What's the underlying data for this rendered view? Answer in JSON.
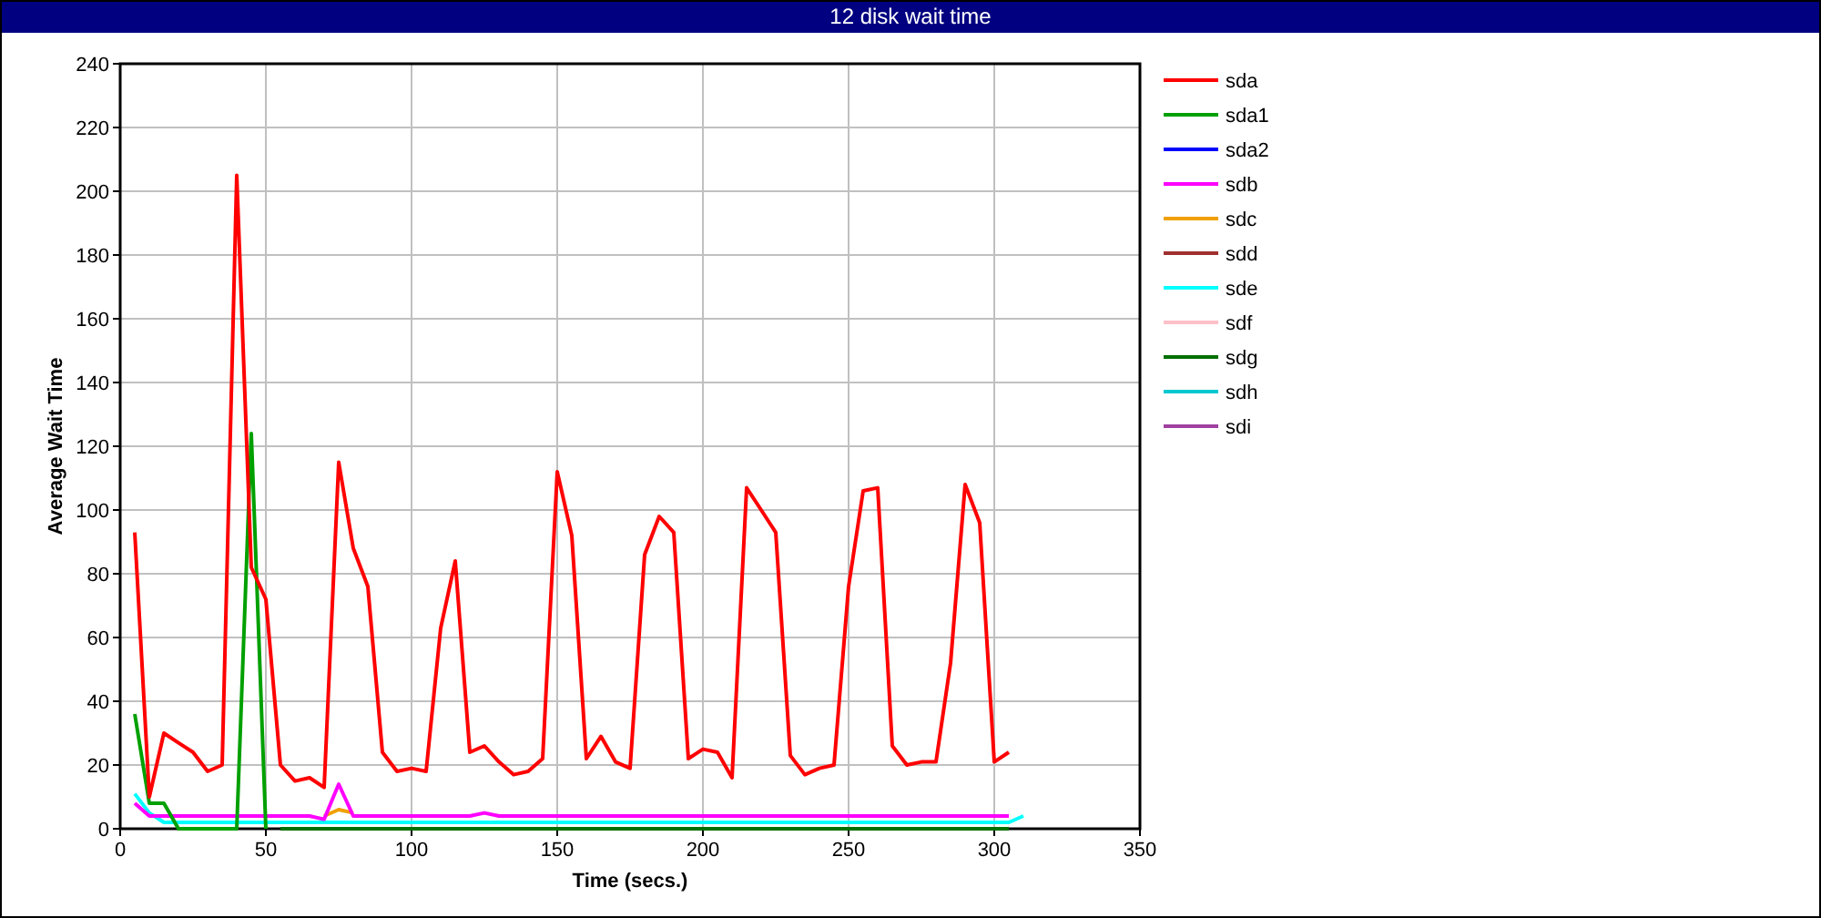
{
  "window": {
    "title": "12 disk wait time"
  },
  "chart": {
    "chart_data": {
      "type": "line",
      "xlabel": "Time (secs.)",
      "ylabel": "Average Wait Time",
      "grid": true,
      "legend": "right",
      "x": [
        5,
        10,
        15,
        20,
        25,
        30,
        35,
        40,
        45,
        50,
        55,
        60,
        65,
        70,
        75,
        80,
        85,
        90,
        95,
        100,
        105,
        110,
        115,
        120,
        125,
        130,
        135,
        140,
        145,
        150,
        155,
        160,
        165,
        170,
        175,
        180,
        185,
        190,
        195,
        200,
        205,
        210,
        215,
        220,
        225,
        230,
        235,
        240,
        245,
        250,
        255,
        260,
        265,
        270,
        275,
        280,
        285,
        290,
        295,
        300,
        305,
        310
      ],
      "xlim": [
        0,
        350
      ],
      "ylim": [
        0,
        240
      ],
      "xticks": [
        0,
        50,
        100,
        150,
        200,
        250,
        300,
        350
      ],
      "yticks": [
        0,
        20,
        40,
        60,
        80,
        100,
        120,
        140,
        160,
        180,
        200,
        220,
        240
      ],
      "series": [
        {
          "name": "sda",
          "color": "#ff0000",
          "values": [
            93,
            10,
            30,
            27,
            24,
            18,
            20,
            205,
            82,
            72,
            20,
            15,
            16,
            13,
            115,
            88,
            76,
            24,
            18,
            19,
            18,
            63,
            84,
            24,
            26,
            21,
            17,
            18,
            22,
            112,
            92,
            22,
            29,
            21,
            19,
            86,
            98,
            93,
            22,
            25,
            24,
            16,
            107,
            100,
            93,
            23,
            17,
            19,
            20,
            76,
            106,
            107,
            26,
            20,
            21,
            21,
            52,
            108,
            96,
            21,
            24,
            null
          ]
        },
        {
          "name": "sda1",
          "color": "#00a000",
          "values": [
            36,
            8,
            8,
            0,
            0,
            0,
            0,
            0,
            124,
            0,
            null,
            null,
            null,
            null,
            null,
            null,
            null,
            null,
            null,
            null,
            null,
            null,
            null,
            null,
            null,
            null,
            null,
            null,
            null,
            null,
            null,
            null,
            null,
            null,
            null,
            null,
            null,
            null,
            null,
            null,
            null,
            null,
            null,
            null,
            null,
            null,
            null,
            null,
            null,
            null,
            null,
            null,
            null,
            null,
            null,
            null,
            null,
            null,
            null,
            null,
            null,
            null
          ]
        },
        {
          "name": "sda2",
          "color": "#0000ff",
          "values": [
            null,
            null,
            null,
            null,
            null,
            null,
            null,
            null,
            null,
            null,
            null,
            null,
            null,
            null,
            null,
            null,
            null,
            null,
            null,
            null,
            null,
            null,
            null,
            null,
            null,
            null,
            null,
            null,
            null,
            null,
            null,
            null,
            null,
            null,
            null,
            null,
            null,
            null,
            null,
            null,
            null,
            null,
            null,
            null,
            null,
            null,
            null,
            null,
            null,
            null,
            null,
            null,
            null,
            null,
            null,
            null,
            null,
            null,
            null,
            null,
            null,
            null
          ]
        },
        {
          "name": "sdb",
          "color": "#ff00ff",
          "values": [
            8,
            4,
            4,
            4,
            4,
            4,
            4,
            4,
            4,
            4,
            4,
            4,
            4,
            3,
            14,
            4,
            4,
            4,
            4,
            4,
            4,
            4,
            4,
            4,
            5,
            4,
            4,
            4,
            4,
            4,
            4,
            4,
            4,
            4,
            4,
            4,
            4,
            4,
            4,
            4,
            4,
            4,
            4,
            4,
            4,
            4,
            4,
            4,
            4,
            4,
            4,
            4,
            4,
            4,
            4,
            4,
            4,
            4,
            4,
            4,
            4,
            null
          ]
        },
        {
          "name": "sdc",
          "color": "#f0a000",
          "values": [
            null,
            null,
            null,
            null,
            null,
            null,
            null,
            null,
            null,
            null,
            null,
            null,
            null,
            4,
            6,
            5,
            null,
            null,
            null,
            null,
            null,
            null,
            null,
            null,
            null,
            null,
            null,
            null,
            null,
            null,
            null,
            null,
            null,
            null,
            null,
            null,
            null,
            null,
            null,
            null,
            null,
            null,
            null,
            null,
            null,
            null,
            null,
            null,
            null,
            null,
            null,
            null,
            null,
            null,
            null,
            null,
            null,
            null,
            null,
            null,
            null,
            null
          ]
        },
        {
          "name": "sdd",
          "color": "#a03030",
          "values": [
            null,
            null,
            null,
            null,
            null,
            null,
            null,
            null,
            null,
            null,
            null,
            null,
            null,
            null,
            null,
            null,
            null,
            null,
            null,
            null,
            null,
            null,
            null,
            null,
            null,
            null,
            null,
            null,
            null,
            null,
            null,
            null,
            null,
            null,
            null,
            null,
            null,
            null,
            null,
            null,
            null,
            null,
            null,
            null,
            null,
            null,
            null,
            null,
            null,
            null,
            null,
            null,
            null,
            null,
            null,
            null,
            null,
            null,
            null,
            null,
            null,
            null
          ]
        },
        {
          "name": "sde",
          "color": "#00ffff",
          "values": [
            11,
            5,
            2,
            2,
            2,
            2,
            2,
            2,
            2,
            2,
            2,
            2,
            2,
            2,
            2,
            2,
            2,
            2,
            2,
            2,
            2,
            2,
            2,
            2,
            2,
            2,
            2,
            2,
            2,
            2,
            2,
            2,
            2,
            2,
            2,
            2,
            2,
            2,
            2,
            2,
            2,
            2,
            2,
            2,
            2,
            2,
            2,
            2,
            2,
            2,
            2,
            2,
            2,
            2,
            2,
            2,
            2,
            2,
            2,
            2,
            2,
            4
          ]
        },
        {
          "name": "sdf",
          "color": "#ffc0c8",
          "values": [
            null,
            null,
            null,
            null,
            null,
            null,
            null,
            null,
            null,
            null,
            null,
            null,
            null,
            null,
            null,
            null,
            null,
            null,
            null,
            null,
            null,
            null,
            null,
            null,
            null,
            null,
            null,
            null,
            null,
            null,
            null,
            null,
            null,
            null,
            null,
            null,
            null,
            null,
            null,
            null,
            null,
            null,
            null,
            null,
            null,
            null,
            null,
            null,
            null,
            null,
            null,
            null,
            null,
            null,
            null,
            null,
            null,
            null,
            null,
            null,
            null,
            null
          ]
        },
        {
          "name": "sdg",
          "color": "#007000",
          "values": [
            null,
            null,
            null,
            null,
            null,
            null,
            null,
            null,
            null,
            null,
            0,
            0,
            0,
            0,
            0,
            0,
            0,
            0,
            0,
            0,
            0,
            0,
            0,
            0,
            0,
            0,
            0,
            0,
            0,
            0,
            0,
            0,
            0,
            0,
            0,
            0,
            0,
            0,
            0,
            0,
            0,
            0,
            0,
            0,
            0,
            0,
            0,
            0,
            0,
            0,
            0,
            0,
            0,
            0,
            0,
            0,
            0,
            0,
            0,
            0,
            0,
            null
          ]
        },
        {
          "name": "sdh",
          "color": "#00c8d0",
          "values": [
            null,
            null,
            null,
            null,
            null,
            null,
            null,
            null,
            null,
            null,
            null,
            null,
            null,
            null,
            null,
            null,
            null,
            null,
            null,
            null,
            null,
            null,
            null,
            null,
            null,
            null,
            null,
            null,
            null,
            null,
            null,
            null,
            null,
            null,
            null,
            null,
            null,
            null,
            null,
            null,
            null,
            null,
            null,
            null,
            null,
            null,
            null,
            null,
            null,
            null,
            null,
            null,
            null,
            null,
            null,
            null,
            null,
            null,
            null,
            null,
            null,
            null
          ]
        },
        {
          "name": "sdi",
          "color": "#a040a0",
          "values": [
            null,
            null,
            null,
            null,
            null,
            null,
            null,
            null,
            null,
            null,
            null,
            null,
            null,
            null,
            null,
            null,
            null,
            null,
            null,
            null,
            null,
            null,
            null,
            null,
            null,
            null,
            null,
            null,
            null,
            null,
            null,
            null,
            null,
            null,
            null,
            null,
            null,
            null,
            null,
            null,
            null,
            null,
            null,
            null,
            null,
            null,
            null,
            null,
            null,
            null,
            null,
            null,
            null,
            null,
            null,
            null,
            null,
            null,
            null,
            null,
            null,
            null
          ]
        }
      ]
    }
  }
}
